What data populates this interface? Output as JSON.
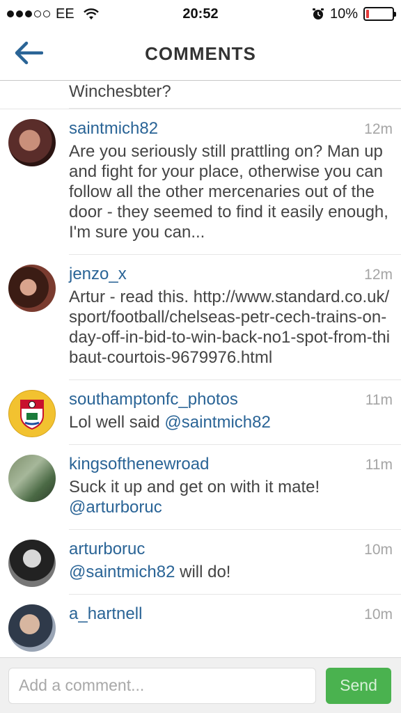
{
  "status_bar": {
    "carrier": "EE",
    "time": "20:52",
    "battery_percent_label": "10%",
    "battery_level": 0.1,
    "signal_bars_filled": 3,
    "signal_bars_total": 5
  },
  "nav": {
    "title": "COMMENTS",
    "back_icon": "back-arrow-icon"
  },
  "partial_comment": {
    "text": "Winchesbter?"
  },
  "comments": [
    {
      "username": "saintmich82",
      "time": "12m",
      "text": "Are you seriously still prattling on? Man up and fight for your place, otherwise you can follow all the other mercenaries out of the door - they seemed to find it easily enough, I'm sure you can..."
    },
    {
      "username": "jenzo_x",
      "time": "12m",
      "text": "Artur - read this. http://www.standard.co.uk/sport/football/chelseas-petr-cech-trains-on-day-off-in-bid-to-win-back-no1-spot-from-thibaut-courtois-9679976.html"
    },
    {
      "username": "southamptonfc_photos",
      "time": "11m",
      "text_prefix": "Lol well said ",
      "mention": "@saintmich82"
    },
    {
      "username": "kingsofthenewroad",
      "time": "11m",
      "text_prefix": "Suck it up and get on with it mate!",
      "mention": "@arturboruc"
    },
    {
      "username": "arturboruc",
      "time": "10m",
      "mention": "@saintmich82",
      "text_suffix": " will do!"
    },
    {
      "username": "a_hartnell",
      "time": "10m"
    }
  ],
  "input_bar": {
    "placeholder": "Add a comment...",
    "send_label": "Send"
  },
  "colors": {
    "username": "#2a6496",
    "send_button": "#4ab24f",
    "back_arrow": "#2a6496",
    "battery_low": "#e43a3a"
  }
}
